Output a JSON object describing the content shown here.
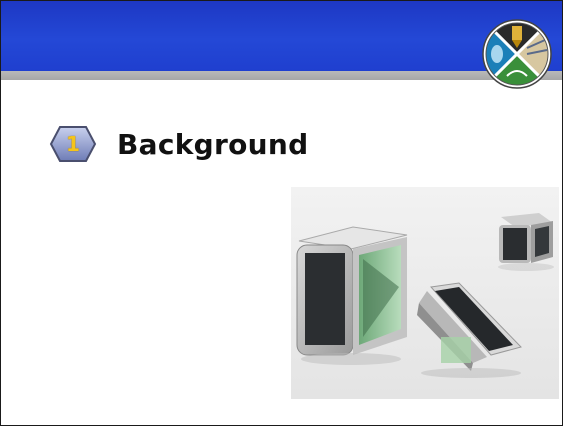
{
  "slide": {
    "title": "Background",
    "section_number": "1"
  },
  "logo": {
    "icon": "circle-emblem-logo-icon"
  },
  "photo": {
    "icon": "modular-cubes-photo"
  },
  "colors": {
    "header_blue": "#2448d6",
    "stripe_gray": "#b0b0b0",
    "badge_number": "#f5c41a",
    "badge_fill": "#8a96c8"
  }
}
